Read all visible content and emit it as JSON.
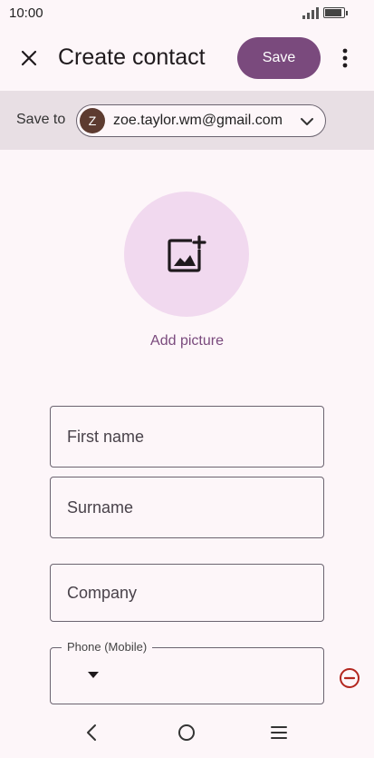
{
  "status_bar": {
    "time": "10:00",
    "battery_level": 0.9
  },
  "app_bar": {
    "title": "Create contact",
    "save_label": "Save",
    "close_icon": "close-icon",
    "more_icon": "more-vert-icon"
  },
  "account": {
    "save_to_label": "Save to",
    "avatar_initial": "Z",
    "email": "zoe.taylor.wm@gmail.com"
  },
  "photo": {
    "add_label": "Add picture",
    "icon": "add-photo-icon"
  },
  "fields": {
    "first_name": {
      "placeholder": "First name",
      "value": ""
    },
    "surname": {
      "placeholder": "Surname",
      "value": ""
    },
    "company": {
      "placeholder": "Company",
      "value": ""
    },
    "phone": {
      "label": "Phone (Mobile)",
      "value": ""
    }
  },
  "colors": {
    "accent": "#7a4a7d",
    "photo_bg": "#f1d9ef",
    "account_bar_bg": "#e8dfe4",
    "remove": "#b3261e"
  }
}
